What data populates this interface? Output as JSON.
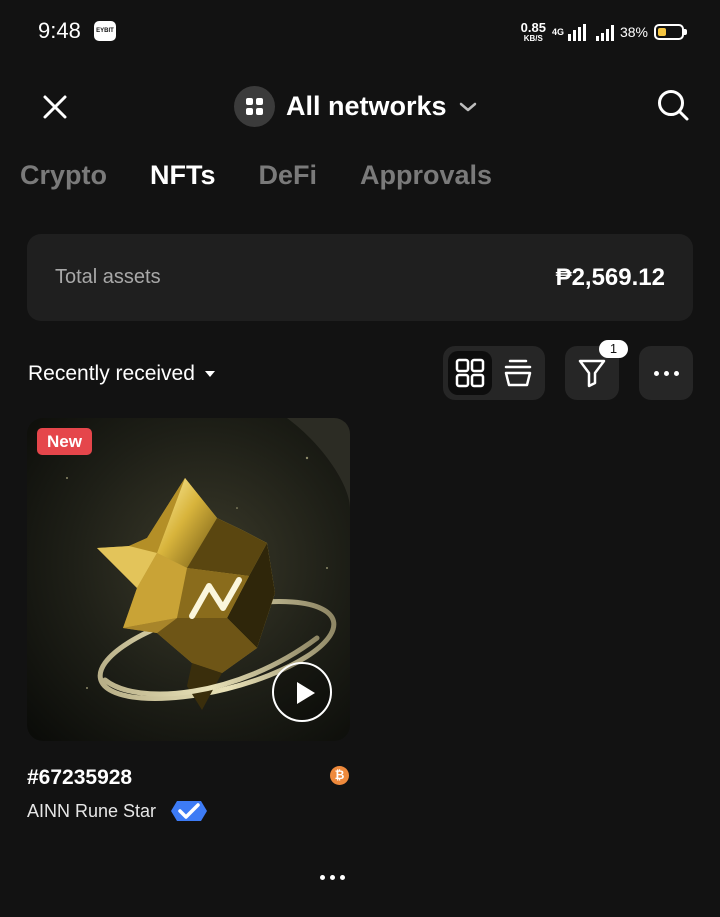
{
  "status_bar": {
    "time": "9:48",
    "app_icon_text": "EYBIT",
    "net_speed": "0.85",
    "net_speed_unit": "KB/S",
    "network_type": "4G",
    "battery_percent": "38%",
    "battery_level": 0.38
  },
  "header": {
    "network_label": "All networks"
  },
  "tabs": [
    {
      "label": "Crypto",
      "active": false
    },
    {
      "label": "NFTs",
      "active": true
    },
    {
      "label": "DeFi",
      "active": false
    },
    {
      "label": "Approvals",
      "active": false
    }
  ],
  "total_assets": {
    "label": "Total assets",
    "value": "₱2,569.12"
  },
  "toolbar": {
    "sort_label": "Recently received",
    "filter_badge": "1"
  },
  "nfts": [
    {
      "badge": "New",
      "token_id": "#67235928",
      "collection": "AINN Rune Star",
      "chain_icon": "bitcoin-icon",
      "chain_symbol": "₿",
      "verified": true
    }
  ],
  "colors": {
    "background": "#121212",
    "card": "#1f1f1f",
    "badge_red": "#e5464b",
    "verified_blue": "#3d7bf5",
    "bitcoin_orange": "#ef8a3c",
    "gold": "#d8b43c"
  }
}
